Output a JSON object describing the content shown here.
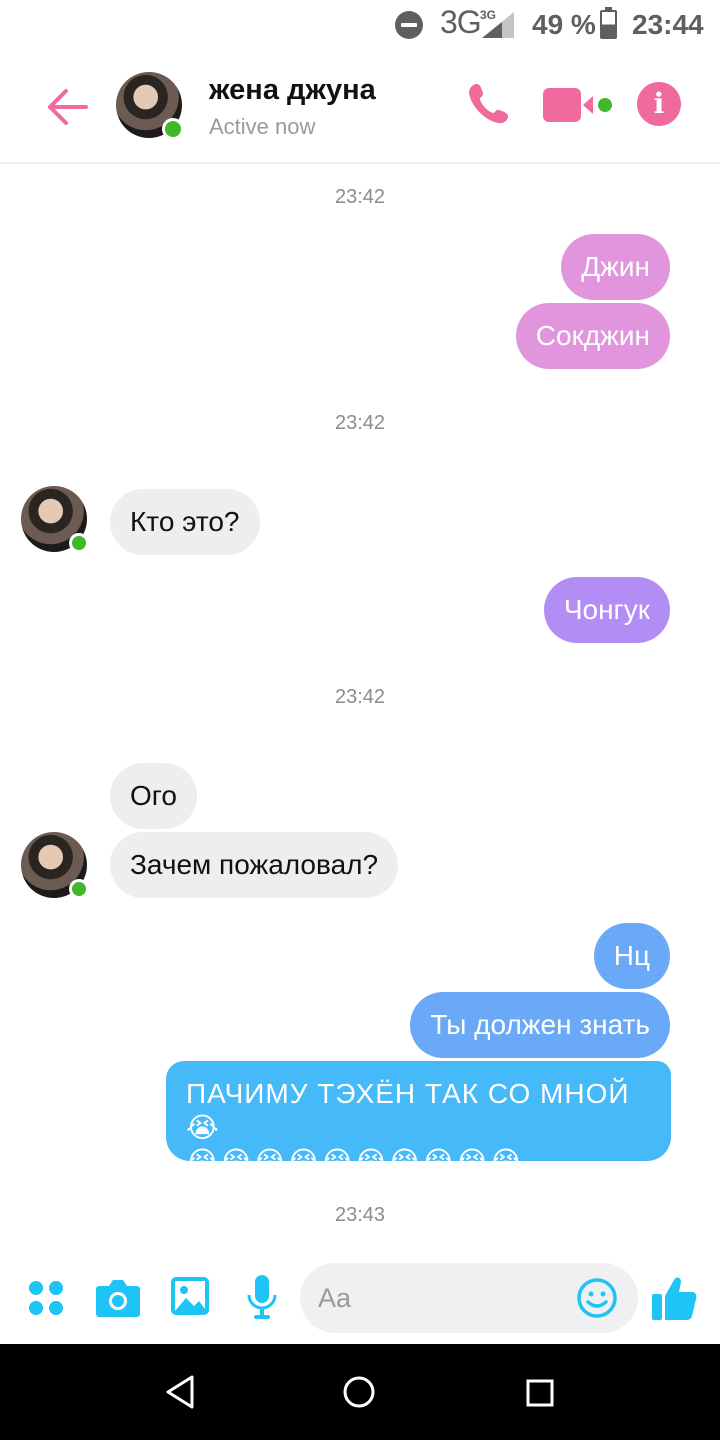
{
  "status_bar": {
    "network": "3G",
    "network_sup": "3G",
    "battery_percent": "49 %",
    "battery_level": 0.49,
    "time": "23:44"
  },
  "header": {
    "contact_name": "жена джуна",
    "status": "Active now",
    "accent_color": "#f06a9e",
    "icons": [
      "back-arrow-icon",
      "phone-icon",
      "video-camera-icon",
      "info-icon"
    ]
  },
  "messages": [
    {
      "type": "time",
      "text": "23:42"
    },
    {
      "type": "outgoing",
      "text": "Джин"
    },
    {
      "type": "outgoing",
      "text": "Сокджин"
    },
    {
      "type": "time",
      "text": "23:42"
    },
    {
      "type": "incoming",
      "text": "Кто это?"
    },
    {
      "type": "outgoing",
      "text": "Чонгук"
    },
    {
      "type": "time",
      "text": "23:42"
    },
    {
      "type": "incoming",
      "text": "Ого"
    },
    {
      "type": "incoming",
      "text": "Зачем пожаловал?"
    },
    {
      "type": "outgoing",
      "text": "Нц"
    },
    {
      "type": "outgoing",
      "text": "Ты должен знать"
    },
    {
      "type": "outgoing",
      "text": "ПАЧИМУ ТЭХЁН ТАК СО МНОЙ😭",
      "line2": "😭😭😭😭😭😭😭😭😭😭"
    },
    {
      "type": "time",
      "text": "23:43"
    }
  ],
  "composer": {
    "placeholder": "Aa",
    "icons": [
      "apps-icon",
      "camera-icon",
      "gallery-icon",
      "microphone-icon",
      "emoji-icon",
      "thumbs-up-icon"
    ],
    "accent_color": "#1ec4f5"
  },
  "navbar": {
    "icons": [
      "back-icon",
      "home-icon",
      "recents-icon"
    ]
  }
}
